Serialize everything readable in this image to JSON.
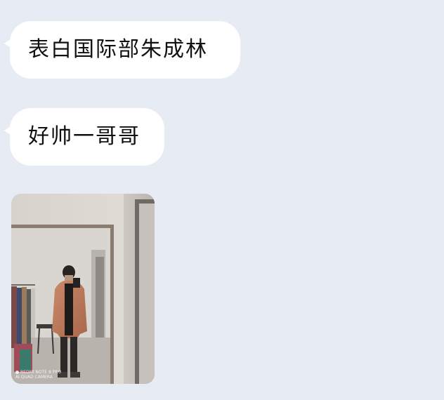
{
  "messages": [
    {
      "text": "表白国际部朱成林"
    },
    {
      "text": "好帅一哥哥"
    }
  ],
  "photo": {
    "watermark_line1": "REDMI NOTE 8 PRO",
    "watermark_line2": "AI QUAD CAMERA"
  },
  "colors": {
    "background": "#e7ebf3",
    "bubble": "#ffffff",
    "text": "#111111"
  }
}
